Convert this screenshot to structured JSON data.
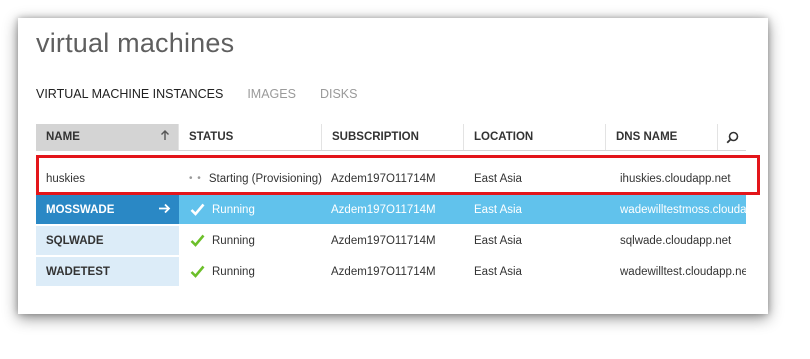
{
  "page": {
    "title": "virtual machines"
  },
  "tabs": [
    {
      "label": "VIRTUAL MACHINE INSTANCES",
      "active": true
    },
    {
      "label": "IMAGES",
      "active": false
    },
    {
      "label": "DISKS",
      "active": false
    }
  ],
  "columns": {
    "name": "NAME",
    "status": "STATUS",
    "subscription": "SUBSCRIPTION",
    "location": "LOCATION",
    "dns": "DNS NAME"
  },
  "rows": [
    {
      "name": "huskies",
      "status": "Starting (Provisioning)",
      "status_icon": "progress-dots-icon",
      "subscription": "Azdem197O11714M",
      "location": "East Asia",
      "dns": "ihuskies.cloudapp.net"
    },
    {
      "name": "MOSSWADE",
      "status": "Running",
      "status_icon": "checkmark-icon",
      "subscription": "Azdem197O11714M",
      "location": "East Asia",
      "dns": "wadewilltestmoss.cloudapp"
    },
    {
      "name": "SQLWADE",
      "status": "Running",
      "status_icon": "checkmark-icon",
      "subscription": "Azdem197O11714M",
      "location": "East Asia",
      "dns": "sqlwade.cloudapp.net"
    },
    {
      "name": "WADETEST",
      "status": "Running",
      "status_icon": "checkmark-icon",
      "subscription": "Azdem197O11714M",
      "location": "East Asia",
      "dns": "wadewilltest.cloudapp.net"
    }
  ],
  "colors": {
    "selected_row": "#61c2ec",
    "selected_name": "#2a88c5",
    "name_cell": "#dcecf8",
    "running_check": "#6cbf2a",
    "highlight": "#e3151a"
  }
}
